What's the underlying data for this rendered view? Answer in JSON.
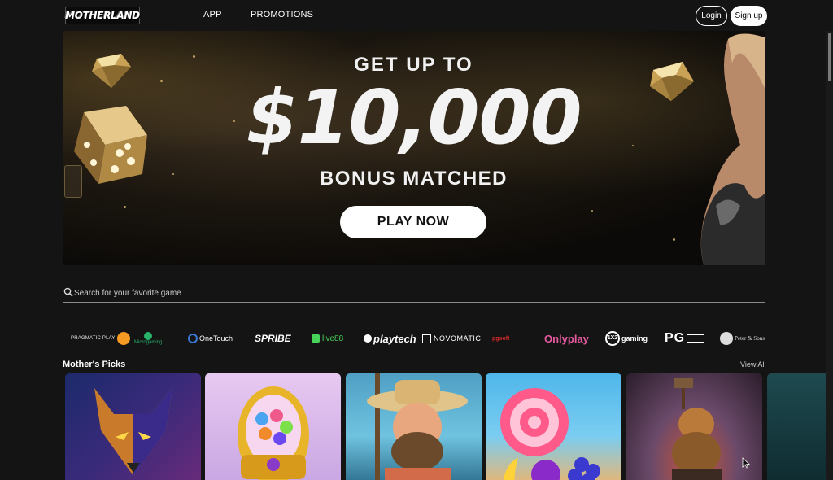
{
  "header": {
    "logo_text": "MOTHERLAND",
    "nav": [
      {
        "label": "APP"
      },
      {
        "label": "PROMOTIONS"
      }
    ],
    "login_label": "Login",
    "signup_label": "Sign up"
  },
  "hero": {
    "subtitle": "GET UP TO",
    "amount": "$10,000",
    "tagline": "BONUS MATCHED",
    "cta_label": "PLAY NOW",
    "accent_color": "#d4a94e"
  },
  "search": {
    "placeholder": "Search for your favorite game"
  },
  "providers": [
    {
      "name": "PRAGMATIC PLAY",
      "icon": "pragmatic-play-logo"
    },
    {
      "name": "Microgaming",
      "icon": "microgaming-logo"
    },
    {
      "name": "OneTouch",
      "icon": "onetouch-logo"
    },
    {
      "name": "SPRIBE",
      "icon": "spribe-logo"
    },
    {
      "name": "live88",
      "icon": "live88-logo"
    },
    {
      "name": "playtech",
      "icon": "playtech-logo"
    },
    {
      "name": "NOVOMATIC",
      "icon": "novomatic-logo"
    },
    {
      "name": "pgsoft",
      "icon": "pgsoft-red-logo"
    },
    {
      "name": "Onlyplay",
      "icon": "onlyplay-logo"
    },
    {
      "name": "gaming",
      "icon": "1x2-gaming-logo"
    },
    {
      "name": "PG",
      "icon": "pocket-games-soft-logo"
    },
    {
      "name": "Peter & Sons",
      "icon": "peter-and-sons-logo"
    }
  ],
  "section": {
    "title": "Mother's Picks",
    "view_all_label": "View All"
  },
  "games": [
    {
      "name": "wolf-game-thumbnail",
      "colors": [
        "#1c2a6b",
        "#6a2a7a"
      ]
    },
    {
      "name": "gumball-egg-game-thumbnail",
      "colors": [
        "#e9c8ef",
        "#c6a3e0"
      ]
    },
    {
      "name": "fisherman-game-thumbnail",
      "colors": [
        "#5aa8c9",
        "#2a6a8a"
      ]
    },
    {
      "name": "candy-fruit-game-thumbnail",
      "colors": [
        "#4fb4e8",
        "#f3b36a"
      ]
    },
    {
      "name": "blacksmith-game-thumbnail",
      "colors": [
        "#6b4a6a",
        "#2a1d2a"
      ]
    },
    {
      "name": "partial-game-thumbnail",
      "colors": [
        "#1e4a4f",
        "#0e2a2f"
      ]
    }
  ]
}
